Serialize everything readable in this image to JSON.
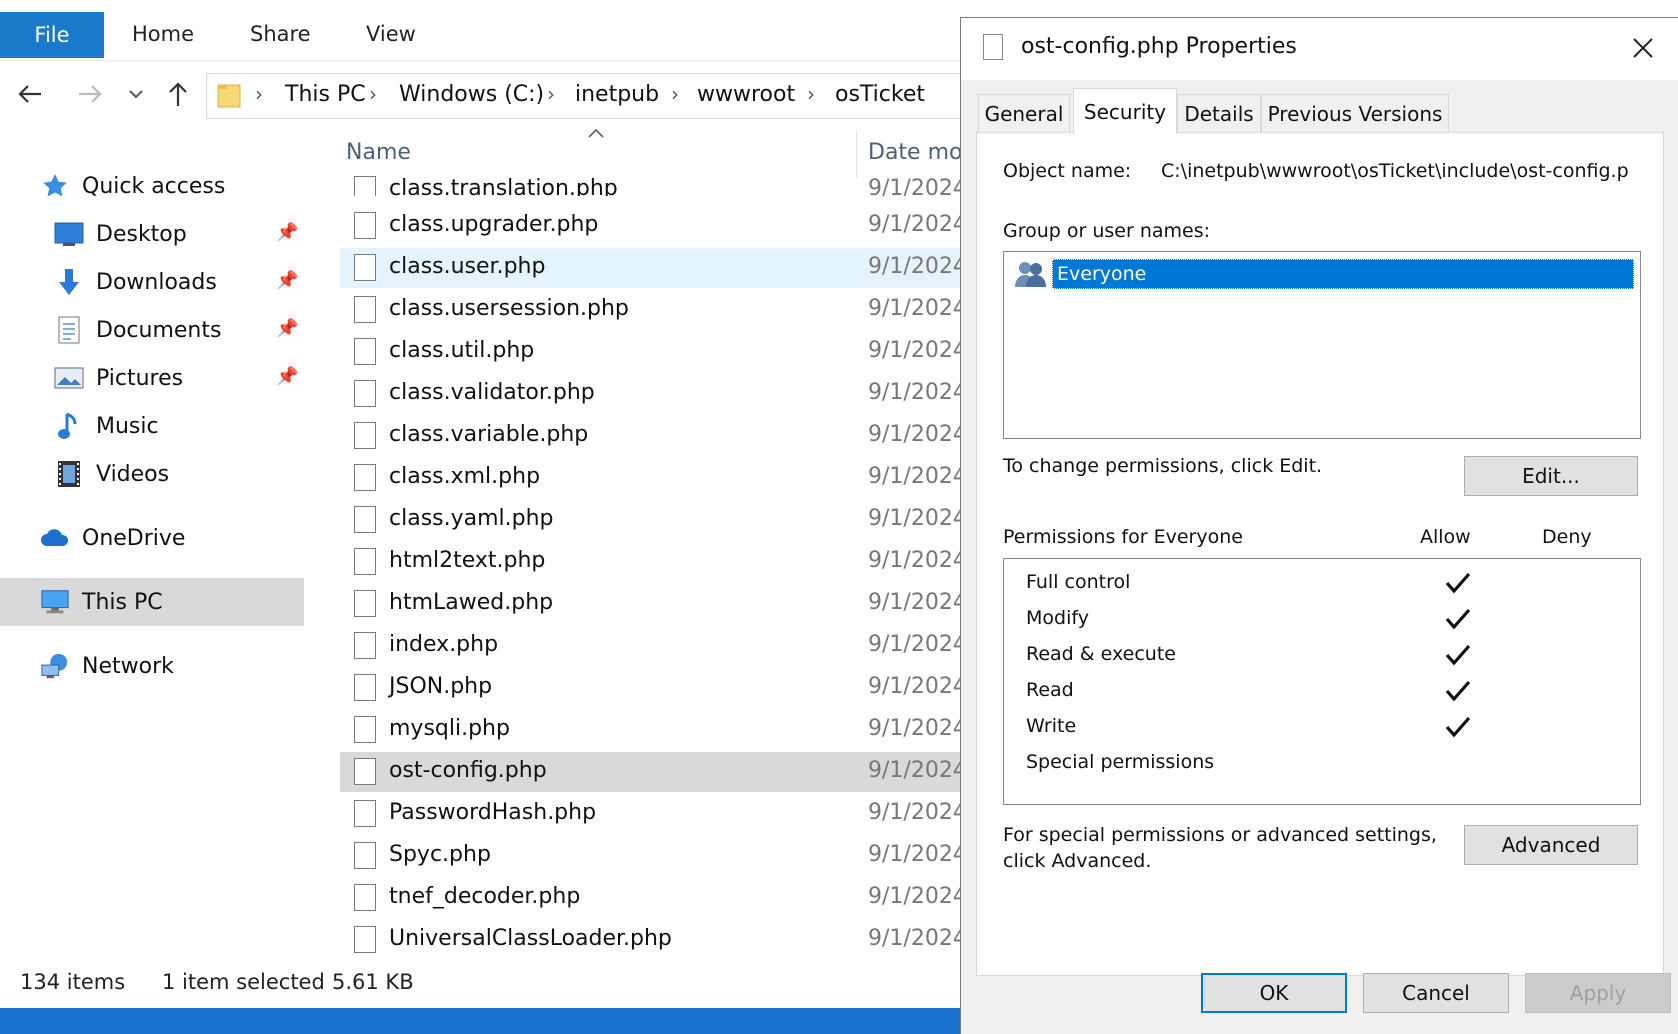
{
  "ribbon": {
    "file_tab": "File",
    "tabs": [
      "Home",
      "Share",
      "View"
    ]
  },
  "nav_buttons": [
    "back-icon",
    "forward-icon",
    "recent-locations-icon",
    "up-icon"
  ],
  "address": {
    "crumbs": [
      "This PC",
      "Windows (C:)",
      "inetpub",
      "wwwroot",
      "osTicket"
    ]
  },
  "sidebar": {
    "items": [
      {
        "label": "Quick access",
        "icon": "star-icon"
      },
      {
        "label": "Desktop",
        "icon": "desktop-icon",
        "pinned": true
      },
      {
        "label": "Downloads",
        "icon": "download-icon",
        "pinned": true
      },
      {
        "label": "Documents",
        "icon": "documents-icon",
        "pinned": true
      },
      {
        "label": "Pictures",
        "icon": "pictures-icon",
        "pinned": true
      },
      {
        "label": "Music",
        "icon": "music-icon"
      },
      {
        "label": "Videos",
        "icon": "videos-icon"
      },
      {
        "label": "OneDrive",
        "icon": "cloud-icon"
      },
      {
        "label": "This PC",
        "icon": "computer-icon",
        "selected": true
      },
      {
        "label": "Network",
        "icon": "network-icon"
      }
    ]
  },
  "file_list": {
    "columns": {
      "name": "Name",
      "date": "Date mo"
    },
    "rows": [
      {
        "name": "class.translation.php",
        "date": "9/1/2024"
      },
      {
        "name": "class.upgrader.php",
        "date": "9/1/2024"
      },
      {
        "name": "class.user.php",
        "date": "9/1/2024",
        "state": "hover"
      },
      {
        "name": "class.usersession.php",
        "date": "9/1/2024"
      },
      {
        "name": "class.util.php",
        "date": "9/1/2024"
      },
      {
        "name": "class.validator.php",
        "date": "9/1/2024"
      },
      {
        "name": "class.variable.php",
        "date": "9/1/2024"
      },
      {
        "name": "class.xml.php",
        "date": "9/1/2024"
      },
      {
        "name": "class.yaml.php",
        "date": "9/1/2024"
      },
      {
        "name": "html2text.php",
        "date": "9/1/2024"
      },
      {
        "name": "htmLawed.php",
        "date": "9/1/2024"
      },
      {
        "name": "index.php",
        "date": "9/1/2024"
      },
      {
        "name": "JSON.php",
        "date": "9/1/2024"
      },
      {
        "name": "mysqli.php",
        "date": "9/1/2024"
      },
      {
        "name": "ost-config.php",
        "date": "9/1/2024",
        "state": "selected"
      },
      {
        "name": "PasswordHash.php",
        "date": "9/1/2024"
      },
      {
        "name": "Spyc.php",
        "date": "9/1/2024"
      },
      {
        "name": "tnef_decoder.php",
        "date": "9/1/2024"
      },
      {
        "name": "UniversalClassLoader.php",
        "date": "9/1/2024"
      }
    ]
  },
  "status": {
    "item_count": "134 items",
    "selection": "1 item selected",
    "size": "5.61 KB"
  },
  "dialog": {
    "title": "ost-config.php Properties",
    "tabs": [
      "General",
      "Security",
      "Details",
      "Previous Versions"
    ],
    "active_tab": "Security",
    "object_name_label": "Object name:",
    "object_name_value": "C:\\inetpub\\wwwroot\\osTicket\\include\\ost-config.p",
    "group_label": "Group or user names:",
    "groups": [
      "Everyone"
    ],
    "change_text": "To change permissions, click Edit.",
    "edit_button": "Edit...",
    "permissions_for": "Permissions for Everyone",
    "allow_label": "Allow",
    "deny_label": "Deny",
    "permissions": [
      {
        "name": "Full control",
        "allow": true,
        "deny": false
      },
      {
        "name": "Modify",
        "allow": true,
        "deny": false
      },
      {
        "name": "Read & execute",
        "allow": true,
        "deny": false
      },
      {
        "name": "Read",
        "allow": true,
        "deny": false
      },
      {
        "name": "Write",
        "allow": true,
        "deny": false
      },
      {
        "name": "Special permissions",
        "allow": false,
        "deny": false
      }
    ],
    "special_text_1": "For special permissions or advanced settings,",
    "special_text_2": "click Advanced.",
    "advanced_button": "Advanced",
    "ok_button": "OK",
    "cancel_button": "Cancel",
    "apply_button": "Apply"
  },
  "colors": {
    "accent": "#0078d7",
    "file_tab": "#1979ca",
    "selection": "#d9d9d9",
    "hover": "#e5f3ff"
  }
}
